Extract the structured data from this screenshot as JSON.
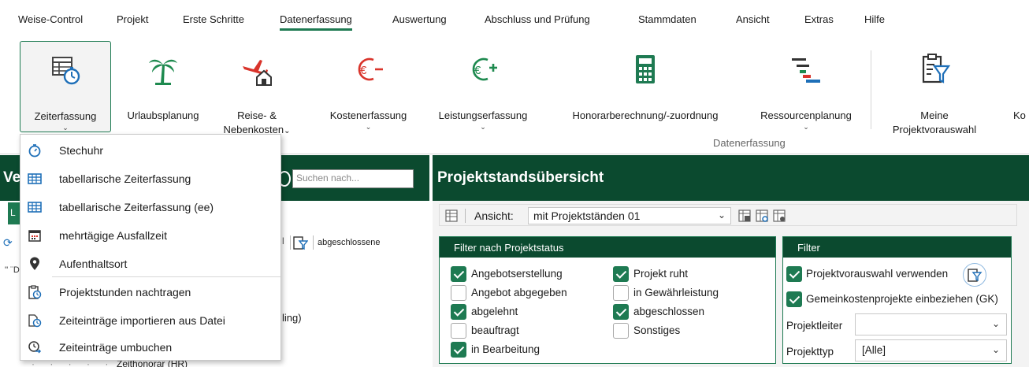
{
  "menubar": {
    "items": [
      {
        "label": "Weise-Control",
        "active": false
      },
      {
        "label": "Projekt",
        "active": false
      },
      {
        "label": "Erste Schritte",
        "active": false
      },
      {
        "label": "Datenerfassung",
        "active": true
      },
      {
        "label": "Auswertung",
        "active": false
      },
      {
        "label": "Abschluss und Prüfung",
        "active": false
      },
      {
        "label": "Stammdaten",
        "active": false
      },
      {
        "label": "Ansicht",
        "active": false
      },
      {
        "label": "Extras",
        "active": false
      },
      {
        "label": "Hilfe",
        "active": false
      }
    ]
  },
  "ribbon": {
    "buttons": [
      {
        "label1": "Zeiterfassung",
        "label2": "",
        "chevron": "⌄",
        "icon": "timesheet-stopwatch-icon"
      },
      {
        "label1": "Urlaubsplanung",
        "label2": "",
        "chevron": "",
        "icon": "palm-tree-icon"
      },
      {
        "label1": "Reise- &",
        "label2": "Nebenkosten",
        "chevron": "⌄",
        "icon": "plane-house-icon"
      },
      {
        "label1": "Kostenerfassung",
        "label2": "",
        "chevron": "⌄",
        "icon": "euro-minus-icon"
      },
      {
        "label1": "Leistungserfassung",
        "label2": "",
        "chevron": "⌄",
        "icon": "euro-plus-icon"
      },
      {
        "label1": "Honorarberechnung/-zuordnung",
        "label2": "",
        "chevron": "",
        "icon": "calculator-icon"
      },
      {
        "label1": "Ressourcenplanung",
        "label2": "",
        "chevron": "⌄",
        "icon": "gantt-bars-icon"
      },
      {
        "label1": "Meine",
        "label2": "Projektvorauswahl",
        "chevron": "",
        "icon": "clipboard-filter-icon"
      },
      {
        "label1": "Ko",
        "label2": "",
        "chevron": "",
        "icon": ""
      }
    ],
    "group_label": "Datenerfassung"
  },
  "dropdown": {
    "items": [
      {
        "label": "Stechuhr",
        "icon": "stopwatch-icon"
      },
      {
        "label": "tabellarische Zeiterfassung",
        "icon": "table-icon"
      },
      {
        "label": "tabellarische Zeiterfassung (ee)",
        "icon": "table-icon"
      },
      {
        "label": "mehrtägige Ausfallzeit",
        "icon": "calendar-icon"
      },
      {
        "label": "Aufenthaltsort",
        "icon": "location-pin-icon"
      },
      {
        "label": "Projektstunden nachtragen",
        "icon": "clipboard-clock-icon"
      },
      {
        "label": "Zeiteinträge importieren aus Datei",
        "icon": "file-clock-icon"
      },
      {
        "label": "Zeiteinträge umbuchen",
        "icon": "clock-arrow-icon"
      }
    ]
  },
  "left_panel": {
    "title_fragment": "Ve",
    "search_placeholder": "Suchen nach...",
    "tab_fragment": "L",
    "toolbar_pipe": "l",
    "toolbar_text": "abgeschlossene",
    "tree_fragment": "'' ¨D",
    "tree_ling": "ling)",
    "tree_last": "Zeithonorar (HR)"
  },
  "right_panel": {
    "title": "Projektstandsübersicht",
    "view_label": "Ansicht:",
    "view_value": "mit Projektständen 01",
    "status_filter": {
      "title": "Filter nach Projektstatus",
      "col1": [
        {
          "label": "Angebotserstellung",
          "checked": true
        },
        {
          "label": "Angebot abgegeben",
          "checked": false
        },
        {
          "label": "abgelehnt",
          "checked": true
        },
        {
          "label": "beauftragt",
          "checked": false
        },
        {
          "label": "in Bearbeitung",
          "checked": true
        }
      ],
      "col2": [
        {
          "label": "Projekt ruht",
          "checked": true
        },
        {
          "label": "in Gewährleistung",
          "checked": false
        },
        {
          "label": "abgeschlossen",
          "checked": true
        },
        {
          "label": "Sonstiges",
          "checked": false
        }
      ]
    },
    "filter": {
      "title": "Filter",
      "use_preselection": {
        "label": "Projektvorauswahl verwenden",
        "checked": true
      },
      "include_overhead": {
        "label": "Gemeinkostenprojekte einbeziehen (GK)",
        "checked": true
      },
      "project_lead_label": "Projektleiter",
      "project_lead_value": "",
      "project_type_label": "Projekttyp",
      "project_type_value": "[Alle]"
    }
  },
  "colors": {
    "accent_green": "#1e7a52",
    "header_dark_green": "#0b4a2f",
    "palm_green": "#1e8a4f",
    "plane_red": "#d9342b",
    "euro_red": "#d9342b",
    "euro_green": "#1e8a4f",
    "calc_green": "#1e7a52",
    "icon_blue": "#1e6fb8"
  }
}
